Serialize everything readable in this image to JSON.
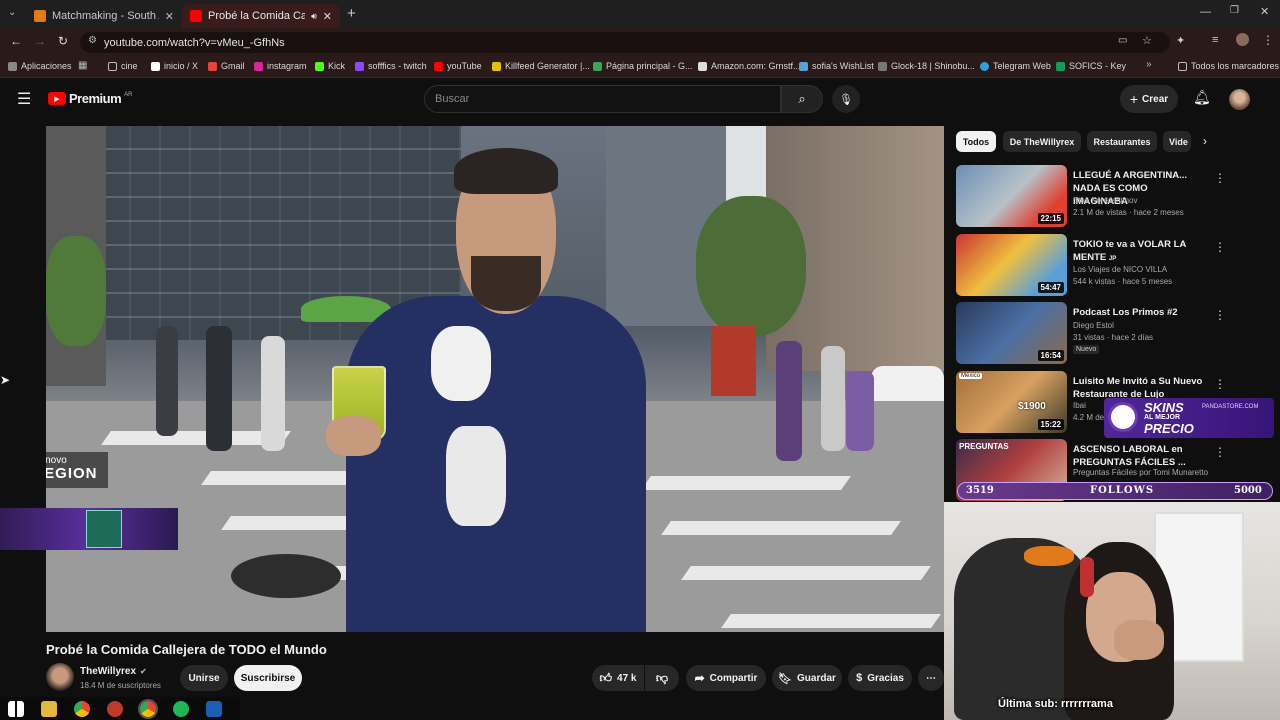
{
  "tabs": [
    {
      "label": "Matchmaking - South America",
      "active": false
    },
    {
      "label": "Probé la Comida Callejera d",
      "active": true
    }
  ],
  "address": {
    "url": "youtube.com/watch?v=vMeu_-GfhNs"
  },
  "bookmarks": [
    "Aplicaciones",
    "cine",
    "inicio / X",
    "Gmail",
    "instagram",
    "Kick",
    "sofffics - twitch",
    "youTube",
    "Killfeed Generator |...",
    "Página principal - G...",
    "Amazon.com: Grnstf...",
    "sofia's WishList",
    "Glock-18 | Shinobu...",
    "Telegram Web",
    "SOFICS - Key",
    "Todos los marcadores"
  ],
  "youtube": {
    "logo_text": "Premium",
    "region": "AR",
    "search_placeholder": "Buscar",
    "create_label": "Crear"
  },
  "video": {
    "overlay_brand_top": "Lenovo",
    "overlay_brand_bottom": "LEGION",
    "title": "Probé la Comida Callejera de TODO el Mundo",
    "channel": "TheWillyrex",
    "subscribers": "18.4 M de suscriptores",
    "join_label": "Unirse",
    "subscribe_label": "Suscribirse",
    "likes": "47 k",
    "share_label": "Compartir",
    "save_label": "Guardar",
    "thanks_label": "Gracias"
  },
  "chips": [
    "Todos",
    "De TheWillyrex",
    "Restaurantes",
    "Vide"
  ],
  "recommendations": [
    {
      "title": "LLEGUÉ A ARGENTINA... NADA ES COMO IMAGINABA",
      "channel": "Stas Konstantinov",
      "meta": "2.1 M de vistas · hace 2 meses",
      "duration": "22:15"
    },
    {
      "title": "TOKIO te va a VOLAR LA MENTE",
      "title_suffix": "JP",
      "channel": "Los Viajes de NICO VILLA",
      "meta": "544 k vistas · hace 5 meses",
      "duration": "54:47"
    },
    {
      "title": "Podcast Los Primos #2",
      "channel": "Diego Estol",
      "meta": "31 vistas · hace 2 días",
      "badge": "Nuevo",
      "duration": "16:54"
    },
    {
      "title": "Luisito Me Invitó a Su Nuevo Restaurante de Lujo",
      "channel": "Ibai",
      "meta": "4.2 M de",
      "duration": "15:22",
      "thumb_tag": "México",
      "thumb_price": "$1900"
    },
    {
      "title": "ASCENSO LABORAL en PREGUNTAS FÁCILES ...",
      "channel": "Preguntas Fáciles por Tomi Munaretto",
      "meta": "",
      "thumb_tag": "PREGUNTAS"
    }
  ],
  "stream_overlay": {
    "ad_line1": "SKINS",
    "ad_line2": "AL MEJOR",
    "ad_line3": "PRECIO",
    "ad_site": "PANDASTORE.COM",
    "follow_current": "3519",
    "follow_label": "FOLLOWS",
    "follow_goal": "5000",
    "last_sub": "Última sub: rrrrrrrama"
  },
  "colors": {
    "accent_red": "#ff0000",
    "bg": "#0f0f0f",
    "follow_purple": "#6a3a8f"
  }
}
